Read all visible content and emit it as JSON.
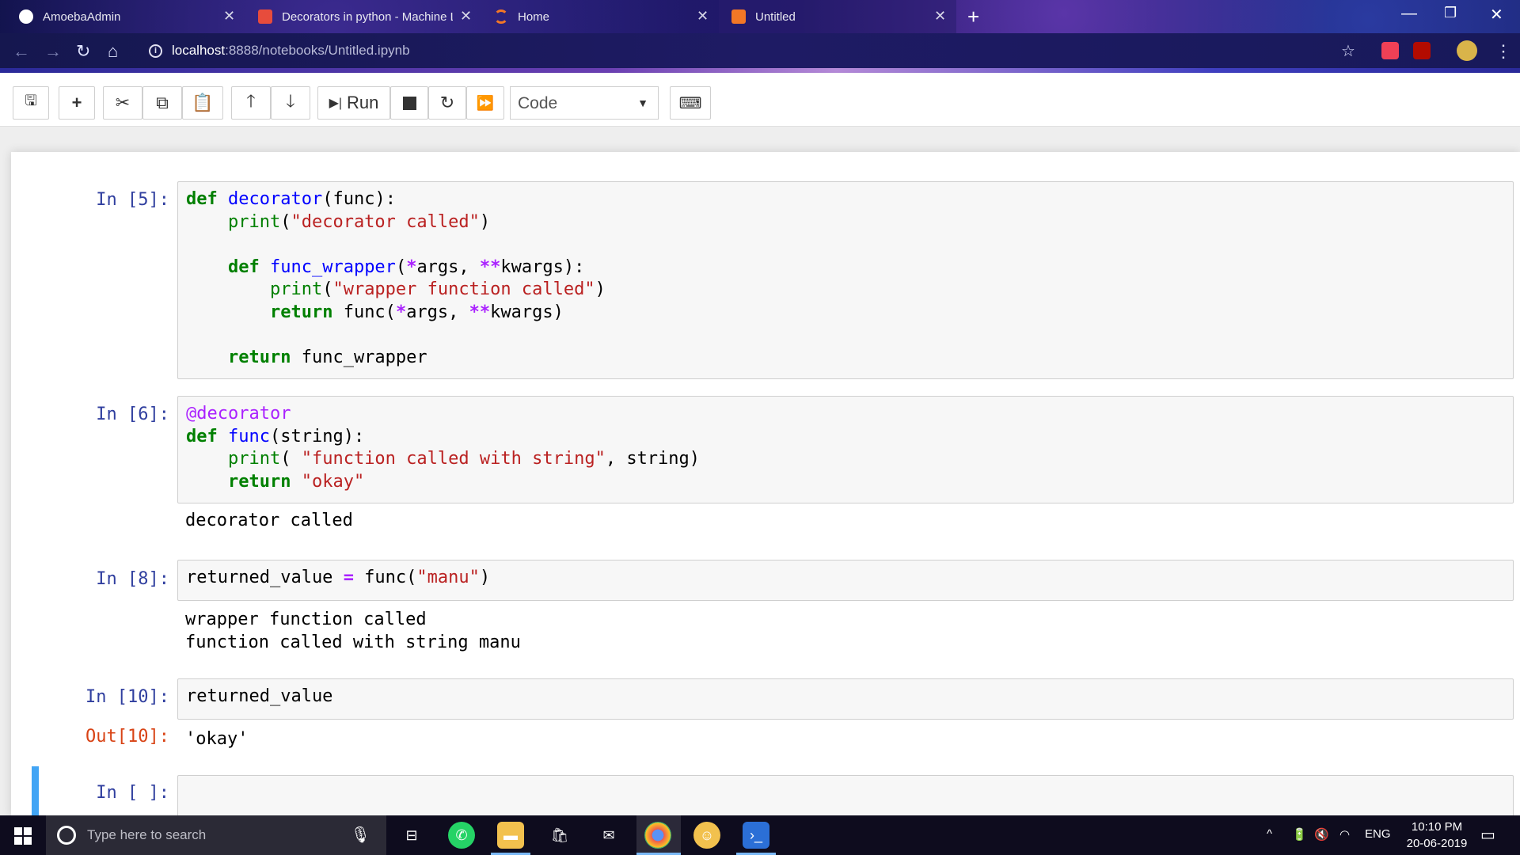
{
  "browser": {
    "tabs": [
      {
        "title": "AmoebaAdmin",
        "color": "#ffffff"
      },
      {
        "title": "Decorators in python - Machine Lea",
        "color": "#e74c3c"
      },
      {
        "title": "Home",
        "color": "#f37726"
      },
      {
        "title": "Untitled",
        "color": "#f37726"
      }
    ],
    "url_host": "localhost",
    "url_rest": ":8888/notebooks/Untitled.ipynb"
  },
  "toolbar": {
    "run_label": "Run",
    "cell_type": "Code"
  },
  "cells": [
    {
      "prompt": "In [5]:"
    },
    {
      "prompt": "In [6]:",
      "output": "decorator called"
    },
    {
      "prompt": "In [8]:",
      "output": "wrapper function called\nfunction called with string manu"
    },
    {
      "prompt": "In [10]:",
      "out_prompt": "Out[10]:",
      "output": "'okay'"
    },
    {
      "prompt": "In [ ]:"
    }
  ],
  "code": {
    "c5": {
      "def": "def",
      "decorator": "decorator",
      "func_param": "(func):",
      "print1": "print",
      "str1": "\"decorator called\"",
      "close1": ")",
      "def2": "def",
      "func_wrapper": "func_wrapper",
      "args_open": "(",
      "star1": "*",
      "args1": "args, ",
      "dstar1": "**",
      "kwargs1": "kwargs):",
      "print2": "print",
      "paren2": "(",
      "str2": "\"wrapper function called\"",
      "close2": ")",
      "return1": "return",
      "ret_call": " func(",
      "star2": "*",
      "args2": "args, ",
      "dstar2": "**",
      "kwargs2": "kwargs)",
      "return2": "return",
      "ret_val": " func_wrapper"
    },
    "c6": {
      "decorator": "@decorator",
      "def": "def",
      "func": "func",
      "param": "(string):",
      "print": "print",
      "paren": "( ",
      "str": "\"function called with string\"",
      "rest": ", string)",
      "return": "return",
      "ret_str": "\"okay\""
    },
    "c8": {
      "var": "returned_value ",
      "eq": "=",
      "call": " func(",
      "str": "\"manu\"",
      "close": ")"
    },
    "c10": {
      "var": "returned_value"
    }
  },
  "taskbar": {
    "search_placeholder": "Type here to search",
    "language": "ENG",
    "time": "10:10 PM",
    "date": "20-06-2019"
  }
}
